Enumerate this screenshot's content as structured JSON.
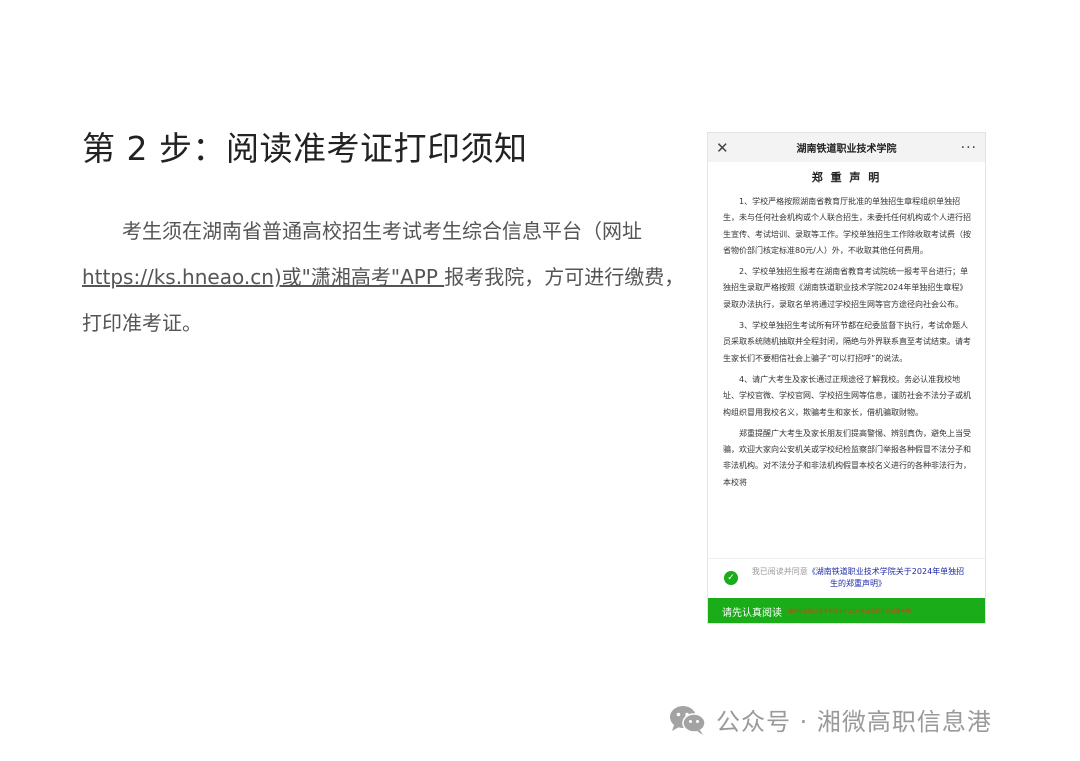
{
  "step_title": "第 2 步：阅读准考证打印须知",
  "intro": {
    "text_before": "考生须在湖南省普通高校招生考试考生综合信息平台（网址",
    "link_text": "https://ks.hneao.cn)或\"潇湘高考\"APP ",
    "text_after": "报考我院，方可进行缴费，打印准考证。"
  },
  "phone": {
    "header_title": "湖南铁道职业技术学院",
    "close_icon": "close-icon",
    "more_icon": "more-icon",
    "notice_title": "郑 重 声 明",
    "paragraphs": [
      "1、学校严格按照湖南省教育厅批准的单独招生章程组织单独招生，未与任何社会机构或个人联合招生，未委托任何机构或个人进行招生宣传、考试培训、录取等工作。学校单独招生工作除收取考试费（按省物价部门核定标准80元/人）外，不收取其他任何费用。",
      "2、学校单独招生报考在湖南省教育考试院统一报考平台进行；单独招生录取严格按照《湖南铁道职业技术学院2024年单独招生章程》录取办法执行，录取名单将通过学校招生网等官方途径向社会公布。",
      "3、学校单独招生考试所有环节都在纪委监督下执行，考试命题人员采取系统随机抽取并全程封闭，隔绝与外界联系直至考试结束。请考生家长们不要相信社会上骗子“可以打招呼”的说法。",
      "4、请广大考生及家长通过正规途径了解我校。务必认准我校地址、学校官微、学校官网、学校招生网等信息，谨防社会不法分子或机构组织冒用我校名义，欺骗考生和家长，借机骗取财物。",
      "郑重提醒广大考生及家长朋友们提高警惕、辨别真伪，避免上当受骗，欢迎大家向公安机关或学校纪检监察部门举报各种假冒不法分子和非法机构。对不法分子和非法机构假冒本校名义进行的各种非法行为，本校将"
    ],
    "agree_prefix": "我已阅读并同意",
    "agree_doc": "《湖南铁道职业技术学院关于2024年单独招生的郑重声明》",
    "read_button": "请先认真阅读",
    "read_hint": "湖南铁道职业技术学院关于2024年单独招生的郑重声明"
  },
  "watermark": {
    "icon": "wechat-icon",
    "text": "公众号 · 湘微高职信息港"
  },
  "colors": {
    "accent_green": "#1aad19",
    "link_blue": "#1c2aa8",
    "hint_red": "#d83a1a"
  }
}
